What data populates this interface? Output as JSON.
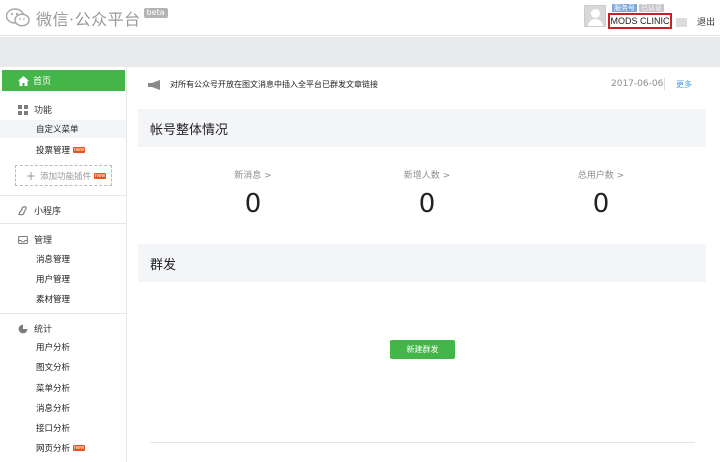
{
  "header": {
    "logo_text": "微信·公众平台",
    "beta_label": "beta",
    "badges": [
      "服务号",
      "已认证"
    ],
    "account_name": "MODS CLINIC",
    "logout_label": "退出"
  },
  "sidebar": {
    "home_label": "首页",
    "sections": [
      {
        "title": "功能",
        "icon": "grid-icon",
        "items": [
          {
            "label": "自定义菜单",
            "selected": true
          },
          {
            "label": "投票管理",
            "new": true
          }
        ]
      },
      {
        "title": "小程序",
        "icon": "miniprogram-icon",
        "items": []
      },
      {
        "title": "管理",
        "icon": "inbox-icon",
        "items": [
          {
            "label": "消息管理"
          },
          {
            "label": "用户管理"
          },
          {
            "label": "素材管理"
          }
        ]
      },
      {
        "title": "统计",
        "icon": "pie-chart-icon",
        "items": [
          {
            "label": "用户分析"
          },
          {
            "label": "图文分析"
          },
          {
            "label": "菜单分析"
          },
          {
            "label": "消息分析"
          },
          {
            "label": "接口分析"
          },
          {
            "label": "网页分析",
            "new": true
          }
        ]
      }
    ],
    "add_plugin_label": "添加功能插件",
    "new_tag_text": "new"
  },
  "notice": {
    "text": "对所有公众号开放在图文消息中插入全平台已群发文章链接",
    "date": "2017-06-06",
    "more_label": "更多"
  },
  "overview": {
    "title": "帐号整体情况",
    "stats": [
      {
        "label": "新消息 >",
        "value": "0"
      },
      {
        "label": "新增人数 >",
        "value": "0"
      },
      {
        "label": "总用户数 >",
        "value": "0"
      }
    ]
  },
  "broadcast": {
    "title": "群发",
    "create_label": "新建群发"
  },
  "colors": {
    "accent_green": "#44b549",
    "highlight_red": "#c8202a",
    "link_blue": "#459ae9"
  }
}
